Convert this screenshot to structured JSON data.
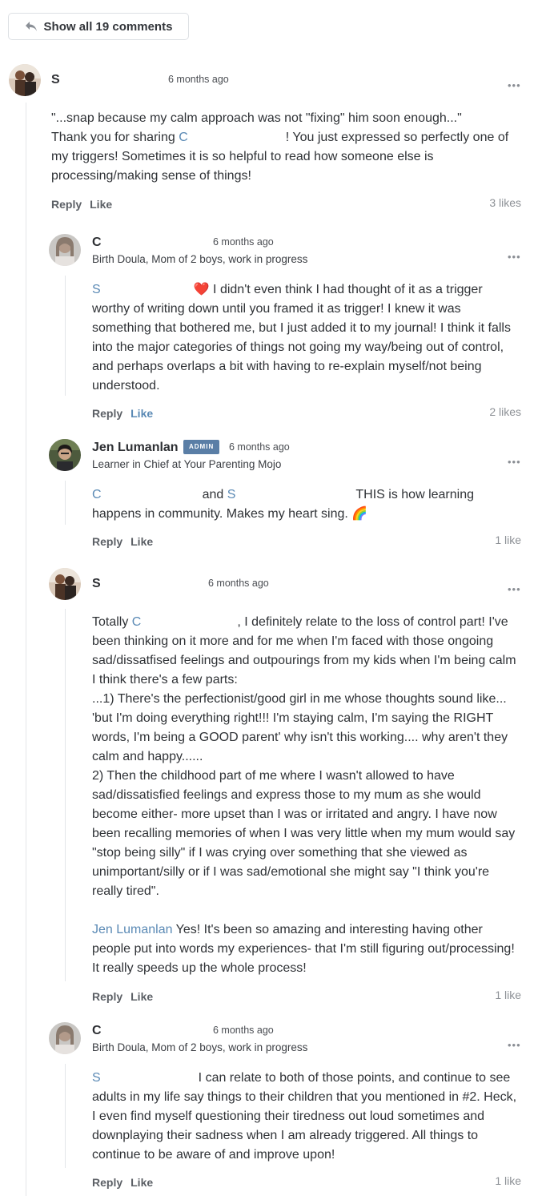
{
  "show_all": {
    "label": "Show all 19 comments"
  },
  "comments": [
    {
      "author": "S",
      "time": "6 months ago",
      "body": {
        "line1": "\"...snap because my calm approach was not \"fixing\" him soon enough...\"",
        "pre": "Thank you for sharing ",
        "mention": "C",
        "post": "! You just expressed so perfectly one of my triggers! Sometimes it is so helpful to read how someone else is processing/making sense of things!"
      },
      "reply_label": "Reply",
      "like_label": "Like",
      "likes": "3 likes"
    },
    {
      "author": "C",
      "time": "6 months ago",
      "subtitle": "Birth Doula, Mom of 2 boys, work in progress",
      "body": {
        "mention": "S",
        "emoji": "❤️",
        "text": "I didn't even think I had thought of it as a trigger worthy of writing down until you framed it as trigger! I knew it was something that bothered me, but I just added it to my journal! I think it falls into the major categories of things not going my way/being out of control, and perhaps overlaps a bit with having to re-explain myself/not being understood."
      },
      "reply_label": "Reply",
      "like_label": "Like",
      "likes": "2 likes"
    },
    {
      "author": "Jen Lumanlan",
      "badge": "ADMIN",
      "time": "6 months ago",
      "subtitle": "Learner in Chief at Your Parenting Mojo",
      "body": {
        "mention1": "C",
        "and": "and",
        "mention2": "S",
        "text": "THIS is how learning happens in community.  Makes my heart sing.",
        "emoji": "🌈"
      },
      "reply_label": "Reply",
      "like_label": "Like",
      "likes": "1 like"
    },
    {
      "author": "S",
      "time": "6 months ago",
      "body": {
        "pre": "Totally ",
        "mention": "C",
        "post": ", I definitely relate to the loss of control part! I've been thinking on it more and for me when I'm faced with those ongoing sad/dissatfised feelings and outpourings from my kids when I'm being calm I think there's a few parts:",
        "p2": "...1) There's the perfectionist/good girl in me whose thoughts sound like... 'but I'm doing everything right!!! I'm staying calm, I'm saying the RIGHT words, I'm being a GOOD parent' why isn't this working.... why aren't they calm and happy......",
        "p3": "2) Then the childhood part of me where I wasn't allowed to have sad/dissatisfied feelings and express those to my mum as she would become either- more upset than I was or irritated and angry. I have now been recalling memories of when I was very little when my mum would say \"stop being silly\" if I was crying over something that she viewed as unimportant/silly or if I was sad/emotional she might say \"I think you're really tired\".",
        "mention2": "Jen Lumanlan",
        "p4": " Yes! It's been so amazing and interesting having other people put into words my experiences- that I'm still figuring out/processing! It really speeds up the whole process!"
      },
      "reply_label": "Reply",
      "like_label": "Like",
      "likes": "1 like"
    },
    {
      "author": "C",
      "time": "6 months ago",
      "subtitle": "Birth Doula, Mom of 2 boys, work in progress",
      "body": {
        "mention": "S",
        "text": "I can relate to both of those points, and continue to see adults in my life say things to their children that you mentioned in #2. Heck, I even find myself questioning their tiredness out loud sometimes and downplaying their sadness when I am already triggered. All things to continue to be aware of and improve upon!"
      },
      "reply_label": "Reply",
      "like_label": "Like",
      "likes": "1 like"
    }
  ],
  "more_icon": "more-horizontal-icon",
  "reply_arrow_icon": "reply-arrow-icon",
  "colors": {
    "mention": "#5b8ab5",
    "admin_badge": "#5a7ea6",
    "thread_line": "#e4e6e9"
  }
}
